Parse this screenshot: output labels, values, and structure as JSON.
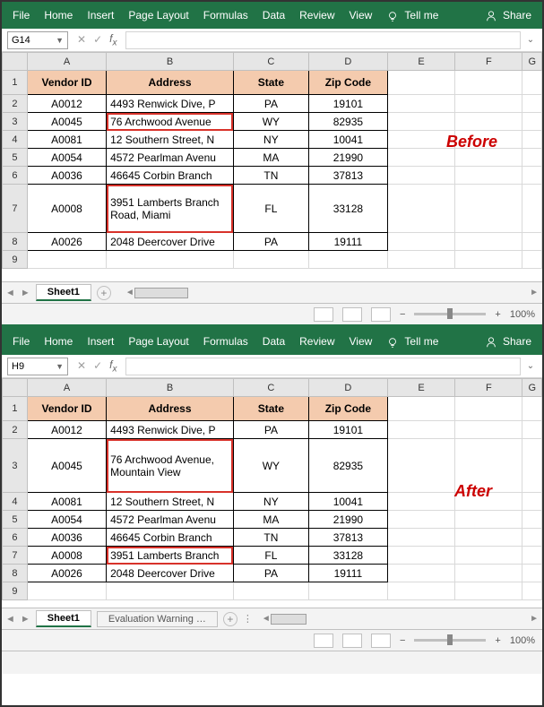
{
  "ribbon": {
    "items": [
      "File",
      "Home",
      "Insert",
      "Page Layout",
      "Formulas",
      "Data",
      "Review",
      "View"
    ],
    "tellme": "Tell me",
    "share": "Share"
  },
  "before": {
    "namebox": "G14",
    "label": "Before",
    "headers": [
      "Vendor ID",
      "Address",
      "State",
      "Zip Code"
    ],
    "cols": [
      "A",
      "B",
      "C",
      "D",
      "E",
      "F",
      "G"
    ],
    "rows": [
      {
        "n": "2",
        "id": "A0012",
        "addr": "4493 Renwick Dive, P",
        "st": "PA",
        "zip": "19101"
      },
      {
        "n": "3",
        "id": "A0045",
        "addr": "76 Archwood Avenue",
        "st": "WY",
        "zip": "82935",
        "red": true
      },
      {
        "n": "4",
        "id": "A0081",
        "addr": "12 Southern Street, N",
        "st": "NY",
        "zip": "10041"
      },
      {
        "n": "5",
        "id": "A0054",
        "addr": "4572 Pearlman Avenu",
        "st": "MA",
        "zip": "21990"
      },
      {
        "n": "6",
        "id": "A0036",
        "addr": "46645 Corbin Branch",
        "st": "TN",
        "zip": "37813"
      },
      {
        "n": "7",
        "id": "A0008",
        "addr": "3951 Lamberts Branch Road, Miami",
        "st": "FL",
        "zip": "33128",
        "wrap": true,
        "red": true
      },
      {
        "n": "8",
        "id": "A0026",
        "addr": "2048 Deercover Drive",
        "st": "PA",
        "zip": "19111"
      }
    ],
    "sheet_tab": "Sheet1",
    "zoom": "100%"
  },
  "after": {
    "namebox": "H9",
    "label": "After",
    "headers": [
      "Vendor ID",
      "Address",
      "State",
      "Zip Code"
    ],
    "cols": [
      "A",
      "B",
      "C",
      "D",
      "E",
      "F",
      "G"
    ],
    "rows": [
      {
        "n": "2",
        "id": "A0012",
        "addr": "4493 Renwick Dive, P",
        "st": "PA",
        "zip": "19101"
      },
      {
        "n": "3",
        "id": "A0045",
        "addr": "76 Archwood Avenue, Mountain View",
        "st": "WY",
        "zip": "82935",
        "wrap": true,
        "red": true
      },
      {
        "n": "4",
        "id": "A0081",
        "addr": "12 Southern Street, N",
        "st": "NY",
        "zip": "10041"
      },
      {
        "n": "5",
        "id": "A0054",
        "addr": "4572 Pearlman Avenu",
        "st": "MA",
        "zip": "21990"
      },
      {
        "n": "6",
        "id": "A0036",
        "addr": "46645 Corbin Branch",
        "st": "TN",
        "zip": "37813"
      },
      {
        "n": "7",
        "id": "A0008",
        "addr": "3951 Lamberts Branch",
        "st": "FL",
        "zip": "33128",
        "red": true
      },
      {
        "n": "8",
        "id": "A0026",
        "addr": "2048 Deercover Drive",
        "st": "PA",
        "zip": "19111"
      }
    ],
    "sheet_tab": "Sheet1",
    "extra_tab": "Evaluation Warning  …",
    "zoom": "100%"
  }
}
